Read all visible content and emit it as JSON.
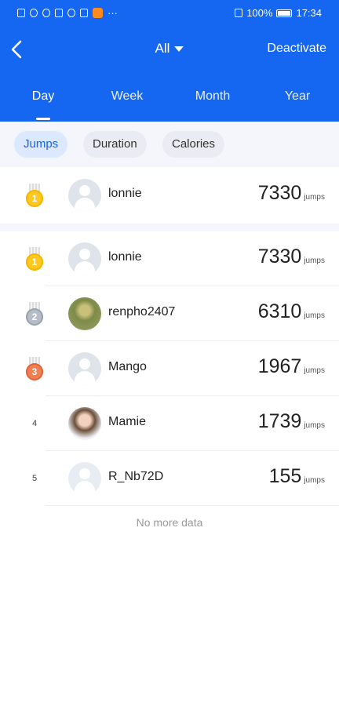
{
  "status_bar": {
    "battery": "100%",
    "time": "17:34",
    "more": "···"
  },
  "topbar": {
    "title": "All",
    "deactivate": "Deactivate"
  },
  "tabs": [
    {
      "label": "Day",
      "active": true
    },
    {
      "label": "Week"
    },
    {
      "label": "Month"
    },
    {
      "label": "Year"
    }
  ],
  "filters": [
    {
      "label": "Jumps",
      "active": true
    },
    {
      "label": "Duration"
    },
    {
      "label": "Calories"
    }
  ],
  "me": {
    "rank": "1",
    "name": "lonnie",
    "value": "7330",
    "unit": "jumps"
  },
  "leaderboard": [
    {
      "rank": "1",
      "name": "lonnie",
      "value": "7330",
      "unit": "jumps"
    },
    {
      "rank": "2",
      "name": "renpho2407",
      "value": "6310",
      "unit": "jumps"
    },
    {
      "rank": "3",
      "name": "Mango",
      "value": "1967",
      "unit": "jumps"
    },
    {
      "rank": "4",
      "name": "Mamie",
      "value": "1739",
      "unit": "jumps"
    },
    {
      "rank": "5",
      "name": "R_Nb72D",
      "value": "155",
      "unit": "jumps"
    }
  ],
  "footer": {
    "no_more": "No more data"
  },
  "colors": {
    "header": "#1566f0",
    "active_chip_text": "#1a64e6"
  }
}
